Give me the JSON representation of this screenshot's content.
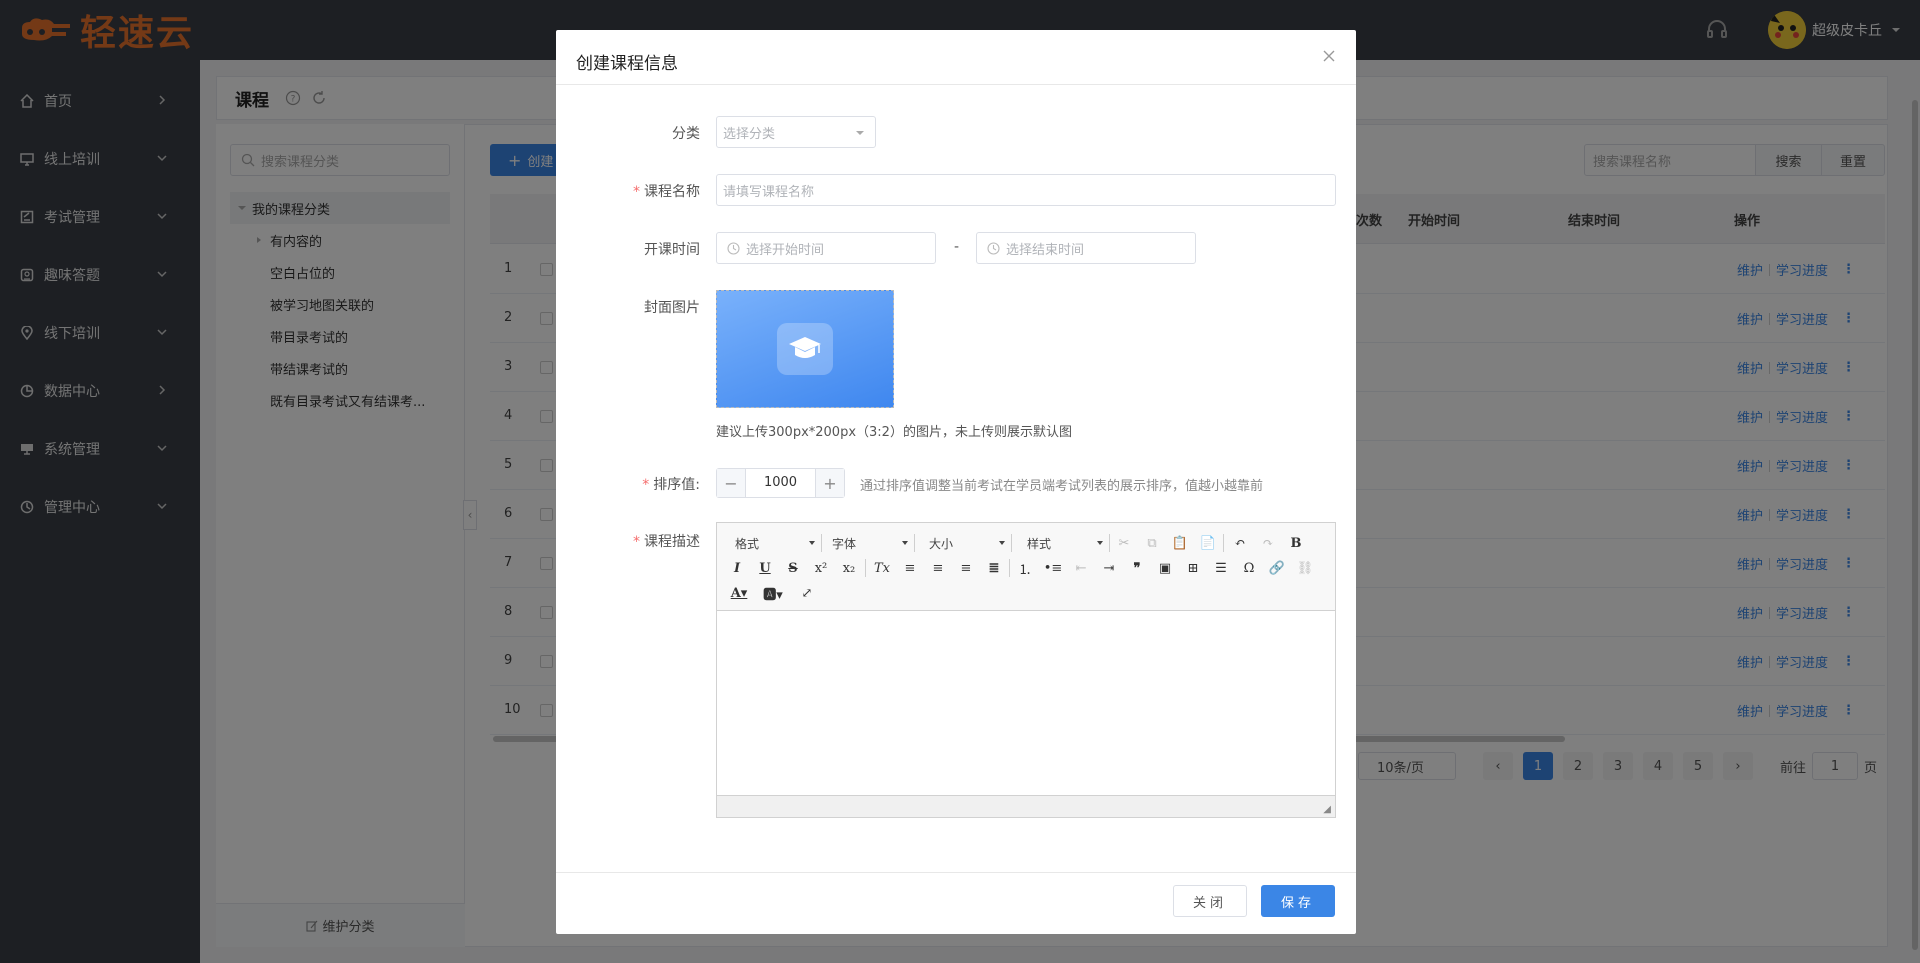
{
  "app": {
    "logo_text": "轻速云",
    "user_name": "超级皮卡丘"
  },
  "sidebar": {
    "items": [
      {
        "label": "首页",
        "icon": "home-icon",
        "chevron": "right"
      },
      {
        "label": "线上培训",
        "icon": "monitor-icon",
        "chevron": "down"
      },
      {
        "label": "考试管理",
        "icon": "exam-icon",
        "chevron": "down"
      },
      {
        "label": "趣味答题",
        "icon": "quiz-icon",
        "chevron": "down"
      },
      {
        "label": "线下培训",
        "icon": "location-icon",
        "chevron": "down"
      },
      {
        "label": "数据中心",
        "icon": "chart-icon",
        "chevron": "right"
      },
      {
        "label": "系统管理",
        "icon": "desktop-icon",
        "chevron": "down"
      },
      {
        "label": "管理中心",
        "icon": "settings-icon",
        "chevron": "down"
      }
    ]
  },
  "page": {
    "title": "课程"
  },
  "category_panel": {
    "search_placeholder": "搜索课程分类",
    "root": "我的课程分类",
    "children": [
      "有内容的",
      "空白占位的",
      "被学习地图关联的",
      "带目录考试的",
      "带结课考试的",
      "既有目录考试又有结课考..."
    ],
    "maintain_label": "维护分类"
  },
  "toolbar": {
    "create_label": "创建",
    "search_placeholder": "搜索课程名称",
    "search_label": "搜索",
    "reset_label": "重置"
  },
  "table": {
    "headers": {
      "count": "次数",
      "start": "开始时间",
      "end": "结束时间",
      "ops": "操作"
    },
    "rows": [
      "1",
      "2",
      "3",
      "4",
      "5",
      "6",
      "7",
      "8",
      "9",
      "10"
    ],
    "action_maintain": "维护",
    "action_progress": "学习进度"
  },
  "pagination": {
    "page_size": "10条/页",
    "pages": [
      "1",
      "2",
      "3",
      "4",
      "5"
    ],
    "current": "1",
    "goto_label": "前往",
    "goto_value": "1",
    "page_suffix": "页"
  },
  "modal": {
    "title": "创建课程信息",
    "category_label": "分类",
    "category_placeholder": "选择分类",
    "name_label": "课程名称",
    "name_placeholder": "请填写课程名称",
    "time_label": "开课时间",
    "start_placeholder": "选择开始时间",
    "time_sep": "-",
    "end_placeholder": "选择结束时间",
    "cover_label": "封面图片",
    "cover_hint": "建议上传300px*200px（3:2）的图片，未上传则展示默认图",
    "sort_label": "排序值:",
    "sort_value": "1000",
    "sort_hint": "通过排序值调整当前考试在学员端考试列表的展示排序，值越小越靠前",
    "desc_label": "课程描述",
    "editor": {
      "format": "格式",
      "font": "字体",
      "size": "大小",
      "style": "样式"
    },
    "close_label": "关闭",
    "save_label": "保存"
  }
}
